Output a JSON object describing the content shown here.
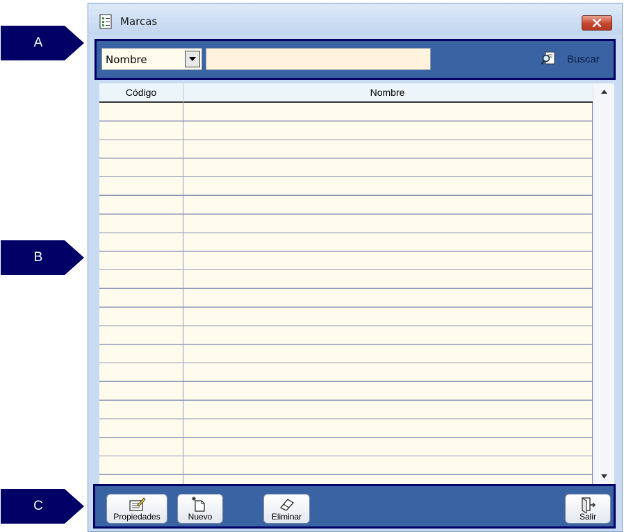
{
  "annotations": [
    "A",
    "B",
    "C"
  ],
  "window": {
    "title": "Marcas",
    "icon": "document-list-icon",
    "close_icon": "close-icon"
  },
  "search": {
    "field_selected": "Nombre",
    "input_value": "",
    "button_label": "Buscar",
    "button_icon": "magnifier-icon"
  },
  "grid": {
    "columns": [
      "Código",
      "Nombre"
    ],
    "rows": []
  },
  "toolbar": {
    "buttons": [
      {
        "label": "Propiedades",
        "icon": "properties-icon"
      },
      {
        "label": "Nuevo",
        "icon": "new-document-icon"
      },
      {
        "label": "Eliminar",
        "icon": "eraser-icon"
      },
      {
        "label": "Salir",
        "icon": "exit-door-icon"
      }
    ]
  },
  "colors": {
    "annotation": "#000066",
    "panel": "#3a63a4",
    "grid_background": "#fffcee",
    "grid_lines": "#8c98b4",
    "close_button": "#c4452e"
  }
}
